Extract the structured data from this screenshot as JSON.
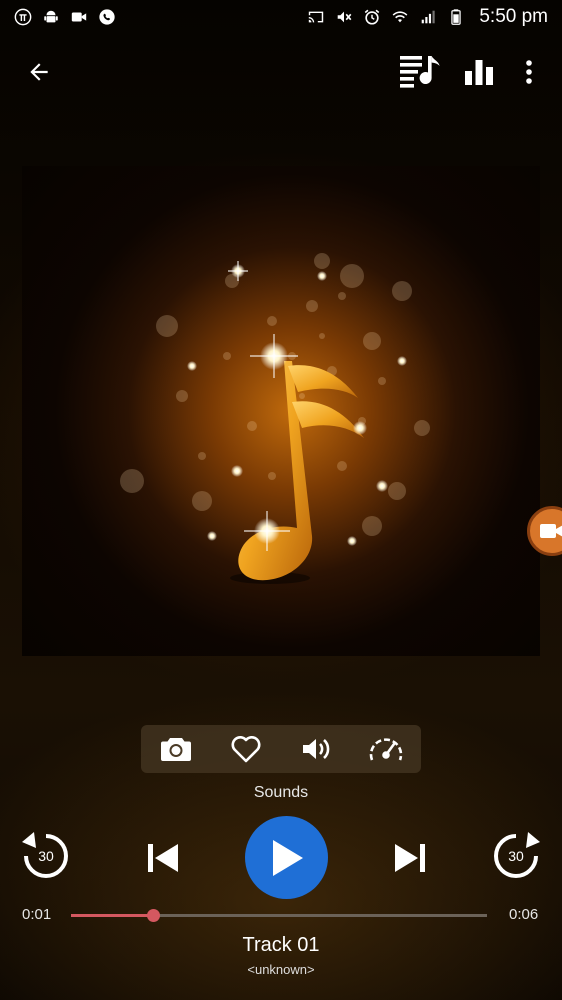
{
  "status_bar": {
    "left_icons": [
      "pi-icon",
      "android-icon",
      "video-call-icon",
      "whatsapp-icon"
    ],
    "right_icons": [
      "cast-icon",
      "mute-icon",
      "alarm-icon",
      "wifi-icon",
      "signal-icon",
      "battery-icon"
    ],
    "time": "5:50 pm"
  },
  "app_bar": {
    "back_icon": "arrow-back-icon",
    "right_icons": [
      "playlist-icon",
      "equalizer-icon",
      "more-vert-icon"
    ]
  },
  "artwork": {
    "description_icon": "music-note-icon"
  },
  "action_bar": {
    "items": [
      "camera-icon",
      "heart-icon",
      "volume-icon",
      "speed-icon"
    ],
    "label": "Sounds"
  },
  "controls": {
    "rewind_seconds": "30",
    "forward_seconds": "30",
    "play_color": "#1f6fd6"
  },
  "progress": {
    "current_time": "0:01",
    "total_time": "0:06",
    "fraction": 0.196
  },
  "track": {
    "title": "Track 01",
    "artist": "<unknown>"
  },
  "colors": {
    "accent": "#1f6fd6",
    "progress": "#d45860",
    "floating_bubble": "#d8762a"
  }
}
